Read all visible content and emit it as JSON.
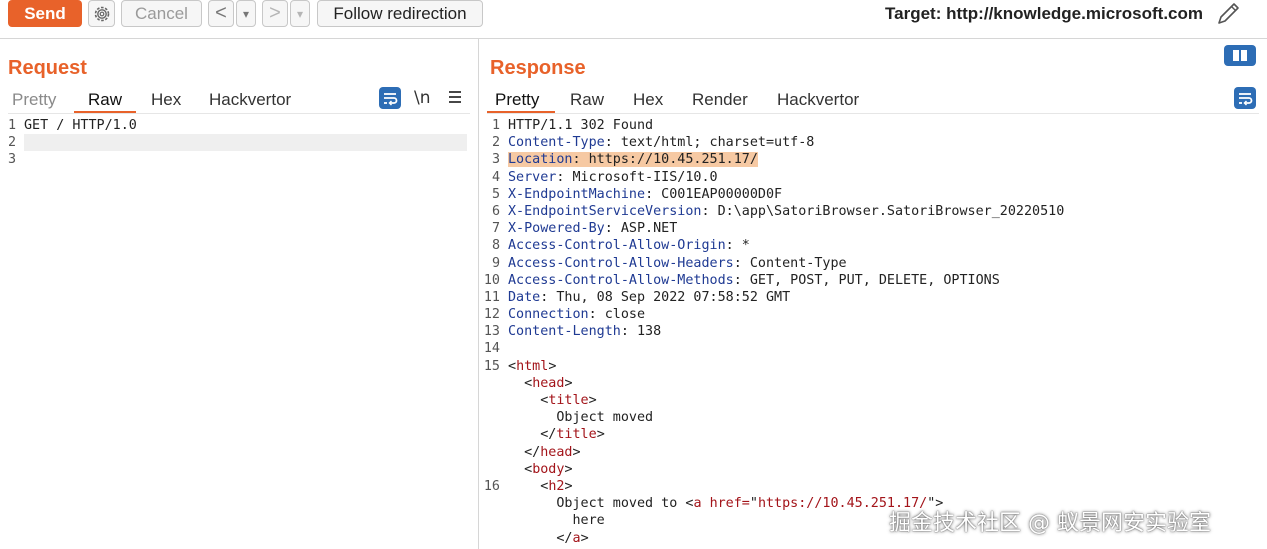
{
  "toolbar": {
    "send_label": "Send",
    "cancel_label": "Cancel",
    "back_label": "<",
    "back_menu_label": "▾",
    "forward_label": ">",
    "forward_menu_label": "▾",
    "follow_label": "Follow redirection",
    "target_label": "Target: http://knowledge.microsoft.com"
  },
  "request": {
    "title": "Request",
    "tabs": [
      "Pretty",
      "Raw",
      "Hex",
      "Hackvertor"
    ],
    "active_tab": "Raw",
    "newline_toggle": "\\n",
    "lines": [
      {
        "n": "1",
        "text": "GET / HTTP/1.0"
      },
      {
        "n": "2",
        "text": ""
      },
      {
        "n": "3",
        "text": ""
      }
    ]
  },
  "response": {
    "title": "Response",
    "tabs": [
      "Pretty",
      "Raw",
      "Hex",
      "Render",
      "Hackvertor"
    ],
    "active_tab": "Pretty",
    "lines": [
      {
        "n": "1",
        "segs": [
          {
            "t": "HTTP/1.1 302 Found",
            "c": "plain"
          }
        ]
      },
      {
        "n": "2",
        "segs": [
          {
            "t": "Content-Type",
            "c": "hname"
          },
          {
            "t": ": text/html; charset=utf-8",
            "c": "hval"
          }
        ]
      },
      {
        "n": "3",
        "segs": [
          {
            "t": "Location",
            "c": "hname loc"
          },
          {
            "t": ": https://10.45.251.17/",
            "c": "hval loc"
          }
        ]
      },
      {
        "n": "4",
        "segs": [
          {
            "t": "Server",
            "c": "hname"
          },
          {
            "t": ": Microsoft-IIS/10.0",
            "c": "hval"
          }
        ]
      },
      {
        "n": "5",
        "segs": [
          {
            "t": "X-EndpointMachine",
            "c": "hname"
          },
          {
            "t": ": C001EAP00000D0F",
            "c": "hval"
          }
        ]
      },
      {
        "n": "6",
        "segs": [
          {
            "t": "X-EndpointServiceVersion",
            "c": "hname"
          },
          {
            "t": ": D:\\app\\SatoriBrowser.SatoriBrowser_20220510",
            "c": "hval"
          }
        ]
      },
      {
        "n": "7",
        "segs": [
          {
            "t": "X-Powered-By",
            "c": "hname"
          },
          {
            "t": ": ASP.NET",
            "c": "hval"
          }
        ]
      },
      {
        "n": "8",
        "segs": [
          {
            "t": "Access-Control-Allow-Origin",
            "c": "hname"
          },
          {
            "t": ": *",
            "c": "hval"
          }
        ]
      },
      {
        "n": "9",
        "segs": [
          {
            "t": "Access-Control-Allow-Headers",
            "c": "hname"
          },
          {
            "t": ": Content-Type",
            "c": "hval"
          }
        ]
      },
      {
        "n": "10",
        "segs": [
          {
            "t": "Access-Control-Allow-Methods",
            "c": "hname"
          },
          {
            "t": ": GET, POST, PUT, DELETE, OPTIONS",
            "c": "hval"
          }
        ]
      },
      {
        "n": "11",
        "segs": [
          {
            "t": "Date",
            "c": "hname"
          },
          {
            "t": ": Thu, 08 Sep 2022 07:58:52 GMT",
            "c": "hval"
          }
        ]
      },
      {
        "n": "12",
        "segs": [
          {
            "t": "Connection",
            "c": "hname"
          },
          {
            "t": ": close",
            "c": "hval"
          }
        ]
      },
      {
        "n": "13",
        "segs": [
          {
            "t": "Content-Length",
            "c": "hname"
          },
          {
            "t": ": 138",
            "c": "hval"
          }
        ]
      },
      {
        "n": "14",
        "segs": []
      },
      {
        "n": "15",
        "segs": [
          {
            "t": "<",
            "c": "plain"
          },
          {
            "t": "html",
            "c": "tagc"
          },
          {
            "t": ">",
            "c": "plain"
          }
        ]
      },
      {
        "n": "",
        "segs": [
          {
            "t": "  <",
            "c": "plain"
          },
          {
            "t": "head",
            "c": "tagc"
          },
          {
            "t": ">",
            "c": "plain"
          }
        ]
      },
      {
        "n": "",
        "segs": [
          {
            "t": "    <",
            "c": "plain"
          },
          {
            "t": "title",
            "c": "tagc"
          },
          {
            "t": ">",
            "c": "plain"
          }
        ]
      },
      {
        "n": "",
        "segs": [
          {
            "t": "      Object moved",
            "c": "plain"
          }
        ]
      },
      {
        "n": "",
        "segs": [
          {
            "t": "    </",
            "c": "plain"
          },
          {
            "t": "title",
            "c": "tagc"
          },
          {
            "t": ">",
            "c": "plain"
          }
        ]
      },
      {
        "n": "",
        "segs": [
          {
            "t": "  </",
            "c": "plain"
          },
          {
            "t": "head",
            "c": "tagc"
          },
          {
            "t": ">",
            "c": "plain"
          }
        ]
      },
      {
        "n": "",
        "segs": [
          {
            "t": "  <",
            "c": "plain"
          },
          {
            "t": "body",
            "c": "tagc"
          },
          {
            "t": ">",
            "c": "plain"
          }
        ]
      },
      {
        "n": "16",
        "segs": [
          {
            "t": "    <",
            "c": "plain"
          },
          {
            "t": "h2",
            "c": "tagc"
          },
          {
            "t": ">",
            "c": "plain"
          }
        ]
      },
      {
        "n": "",
        "segs": [
          {
            "t": "      Object moved to <",
            "c": "plain"
          },
          {
            "t": "a ",
            "c": "tagc"
          },
          {
            "t": "href=",
            "c": "attr"
          },
          {
            "t": "\"",
            "c": "plain"
          },
          {
            "t": "https://10.45.251.17/",
            "c": "attr"
          },
          {
            "t": "\">",
            "c": "plain"
          }
        ]
      },
      {
        "n": "",
        "segs": [
          {
            "t": "        here",
            "c": "plain"
          }
        ]
      },
      {
        "n": "",
        "segs": [
          {
            "t": "      </",
            "c": "plain"
          },
          {
            "t": "a",
            "c": "tagc"
          },
          {
            "t": ">",
            "c": "plain"
          }
        ]
      }
    ]
  },
  "watermark": "掘金技术社区 @ 蚁景网安实验室",
  "colors": {
    "accent": "#e8622a",
    "icon_blue": "#2d6db5",
    "header_name": "#1f3a93",
    "tag": "#a3141a",
    "highlight": "#f6c9a3"
  }
}
